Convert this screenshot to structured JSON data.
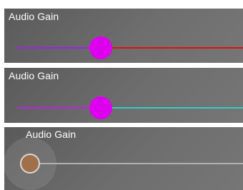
{
  "sliders": [
    {
      "label": "Audio Gain",
      "value_fraction": 0.37,
      "active_color": "#a020f0",
      "inactive_color": "#e01010",
      "thumb_color": "#dd00ee",
      "style": "filled"
    },
    {
      "label": "Audio Gain",
      "value_fraction": 0.37,
      "active_color": "#c020e8",
      "inactive_color": "#30d0c0",
      "thumb_color": "#dd00ee",
      "style": "filled"
    },
    {
      "label": "Audio Gain",
      "value_fraction": 0.0,
      "active_color": "#b0b0b0",
      "inactive_color": "#b0b0b0",
      "thumb_color": "#a0704a",
      "thumb_border_color": "#d8d8d8",
      "style": "focused"
    }
  ]
}
